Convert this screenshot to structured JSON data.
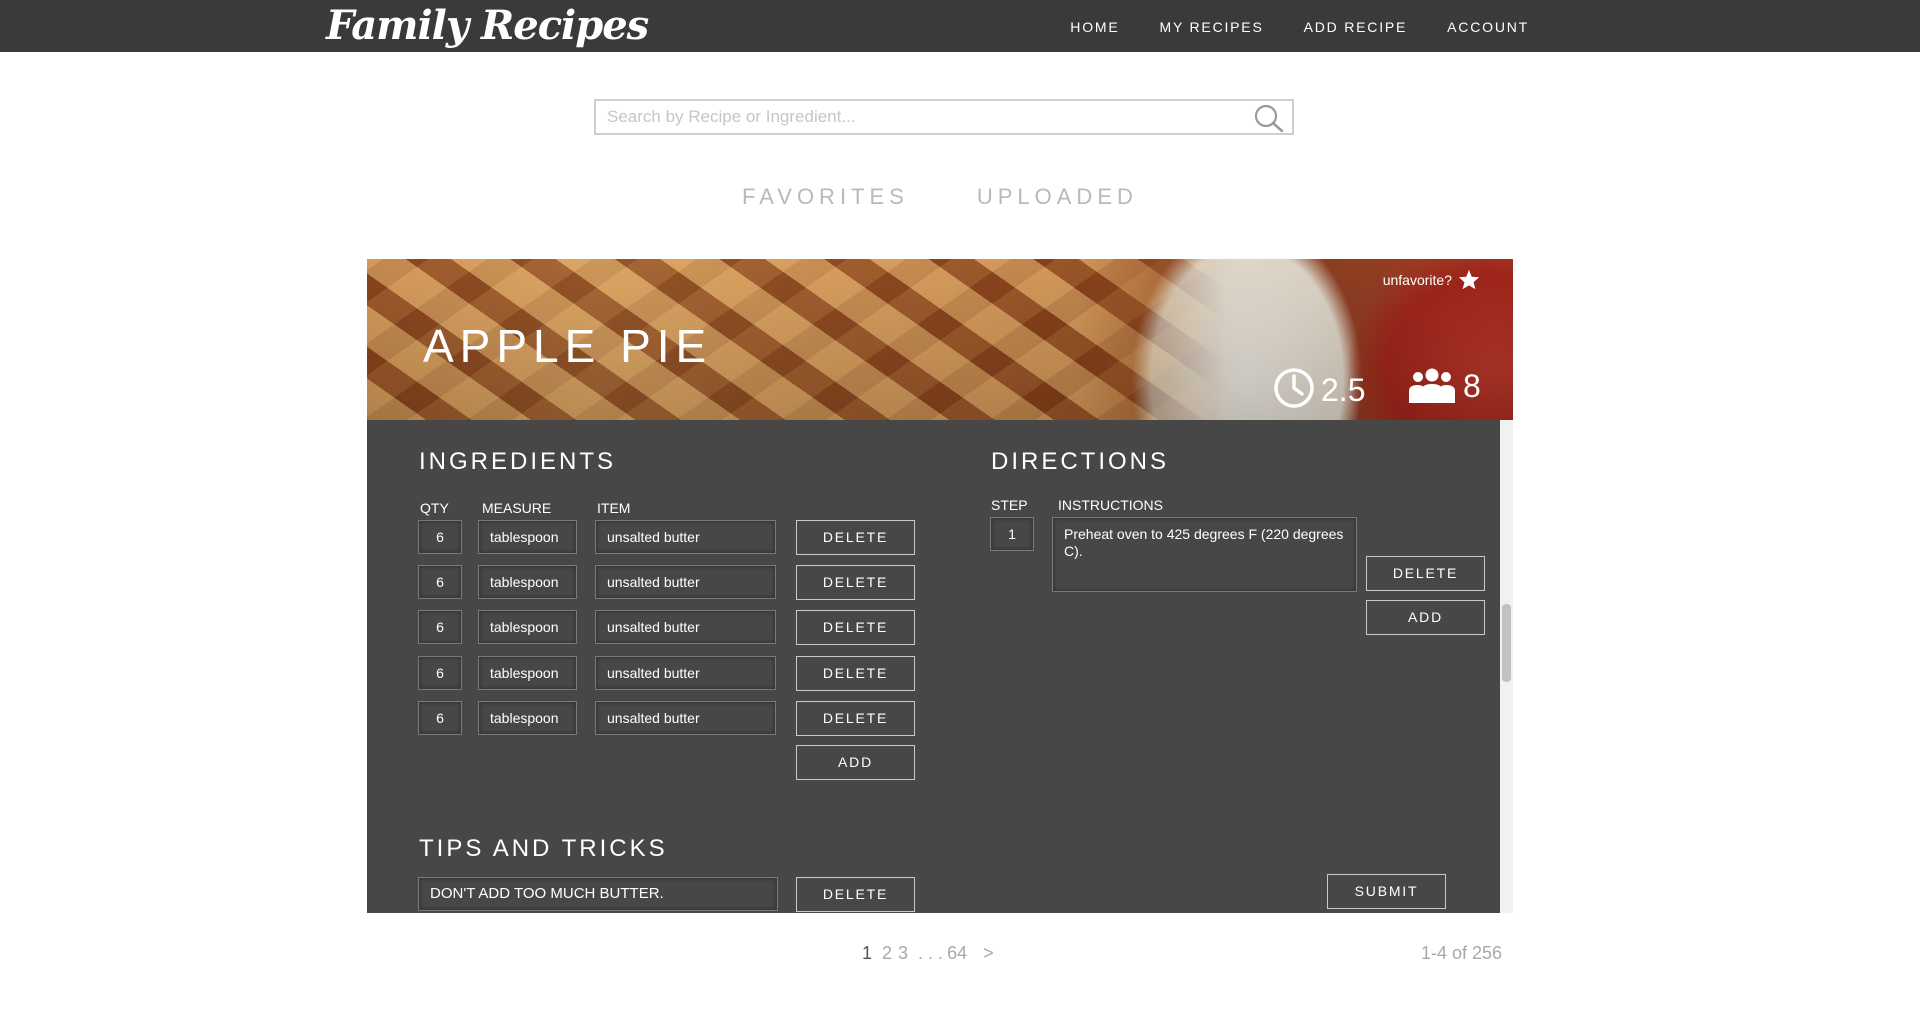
{
  "app": {
    "logo": "Family Recipes"
  },
  "nav": {
    "items": [
      "HOME",
      "MY RECIPES",
      "ADD RECIPE",
      "ACCOUNT"
    ]
  },
  "search": {
    "placeholder": "Search by Recipe or Ingredient...",
    "value": ""
  },
  "tabs": [
    "FAVORITES",
    "UPLOADED"
  ],
  "recipe": {
    "title": "APPLE PIE",
    "unfavorite_label": "unfavorite?",
    "time": "2.5",
    "servings": "8"
  },
  "ingredients": {
    "title": "INGREDIENTS",
    "headers": {
      "qty": "QTY",
      "measure": "MEASURE",
      "item": "ITEM"
    },
    "rows": [
      {
        "qty": "6",
        "measure": "tablespoon",
        "item": "unsalted butter"
      },
      {
        "qty": "6",
        "measure": "tablespoon",
        "item": "unsalted butter"
      },
      {
        "qty": "6",
        "measure": "tablespoon",
        "item": "unsalted butter"
      },
      {
        "qty": "6",
        "measure": "tablespoon",
        "item": "unsalted butter"
      },
      {
        "qty": "6",
        "measure": "tablespoon",
        "item": "unsalted butter"
      }
    ],
    "delete_label": "DELETE",
    "add_label": "ADD"
  },
  "directions": {
    "title": "DIRECTIONS",
    "headers": {
      "step": "STEP",
      "instructions": "INSTRUCTIONS"
    },
    "steps": [
      {
        "step": "1",
        "text": "Preheat oven to 425 degrees F (220 degrees C)."
      }
    ],
    "delete_label": "DELETE",
    "add_label": "ADD"
  },
  "tips": {
    "title": "TIPS AND TRICKS",
    "items": [
      "DON'T ADD TOO MUCH BUTTER."
    ],
    "delete_label": "DELETE"
  },
  "submit_label": "SUBMIT",
  "pagination": {
    "pages": [
      "1",
      "2",
      "3",
      ". . .",
      "64",
      ">"
    ],
    "current": "1",
    "summary": "1-4  of 256"
  },
  "colors": {
    "topbar": "#3a3a3a",
    "panel": "#474747",
    "accent_text": "#ffffff"
  }
}
